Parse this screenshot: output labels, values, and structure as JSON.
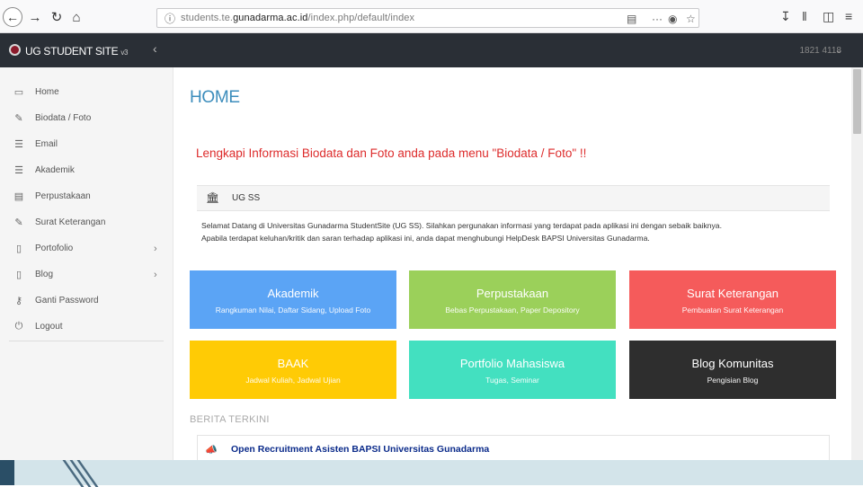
{
  "browser": {
    "url_prefix": "students.te.",
    "url_domain": "gunadarma.ac.id",
    "url_path": "/index.php/default/index"
  },
  "sidebar": {
    "brand": "UG STUDENT SITE",
    "brand_version": "v3",
    "items": [
      {
        "icon": "desktop-icon",
        "label": "Home",
        "has_submenu": false
      },
      {
        "icon": "edit-icon",
        "label": "Biodata / Foto",
        "has_submenu": false
      },
      {
        "icon": "list-icon",
        "label": "Email",
        "has_submenu": false
      },
      {
        "icon": "list-icon",
        "label": "Akademik",
        "has_submenu": false
      },
      {
        "icon": "book-icon",
        "label": "Perpustakaan",
        "has_submenu": false
      },
      {
        "icon": "edit-icon",
        "label": "Surat Keterangan",
        "has_submenu": false
      },
      {
        "icon": "file-icon",
        "label": "Portofolio",
        "has_submenu": true
      },
      {
        "icon": "file-icon",
        "label": "Blog",
        "has_submenu": true
      },
      {
        "icon": "key-icon",
        "label": "Ganti Password",
        "has_submenu": false
      },
      {
        "icon": "power-icon",
        "label": "Logout",
        "has_submenu": false
      }
    ]
  },
  "topbar": {
    "user_id": "1821 4118"
  },
  "main": {
    "title": "HOME",
    "alert": "Lengkapi Informasi Biodata dan Foto anda pada menu \"Biodata / Foto\" !!",
    "announcement": {
      "title": "UG SS",
      "line1": "Selamat Datang di Universitas Gunadarma StudentSite (UG SS). Silahkan pergunakan informasi yang terdapat pada aplikasi ini dengan sebaik baiknya.",
      "line2": "Apabila terdapat keluhan/kritik dan saran terhadap aplikasi ini, anda dapat menghubungi HelpDesk BAPSI Universitas Gunadarma."
    },
    "tiles": [
      {
        "title": "Akademik",
        "subtitle": "Rangkuman Nilai, Daftar Sidang, Upload Foto",
        "color": "#5ba4f5"
      },
      {
        "title": "Perpustakaan",
        "subtitle": "Bebas Perpustakaan, Paper Depository",
        "color": "#9bd05a"
      },
      {
        "title": "Surat Keterangan",
        "subtitle": "Pembuatan Surat Keterangan",
        "color": "#f55b5b"
      },
      {
        "title": "BAAK",
        "subtitle": "Jadwal Kuliah, Jadwal Ujian",
        "color": "#ffcb05"
      },
      {
        "title": "Portfolio Mahasiswa",
        "subtitle": "Tugas, Seminar",
        "color": "#43e0c0"
      },
      {
        "title": "Blog Komunitas",
        "subtitle": "Pengisian Blog",
        "color": "#2e2e2e"
      }
    ],
    "news_heading": "BERITA TERKINI",
    "news_item": "Open Recruitment Asisten BAPSI Universitas Gunadarma"
  }
}
